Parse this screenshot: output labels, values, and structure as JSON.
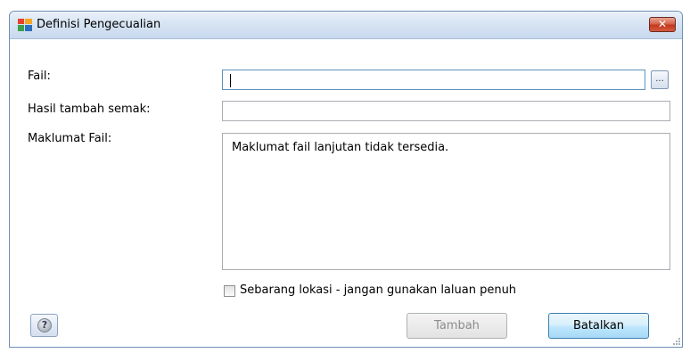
{
  "window": {
    "title": "Definisi Pengecualian",
    "close_label": "✕"
  },
  "form": {
    "file_label": "Fail:",
    "file_value": "",
    "browse_label": "...",
    "checksum_label": "Hasil tambah semak:",
    "checksum_value": "",
    "info_label": "Maklumat Fail:",
    "info_text": "Maklumat fail lanjutan tidak tersedia.",
    "any_location_label": "Sebarang lokasi - jangan gunakan laluan penuh",
    "any_location_checked": false
  },
  "buttons": {
    "help_label": "?",
    "add_label": "Tambah",
    "cancel_label": "Batalkan"
  },
  "colors": {
    "title_bar": "#d7e4f3",
    "close_button": "#c2391f",
    "default_button": "#bee6fd",
    "disabled_text": "#8c8c8c"
  }
}
